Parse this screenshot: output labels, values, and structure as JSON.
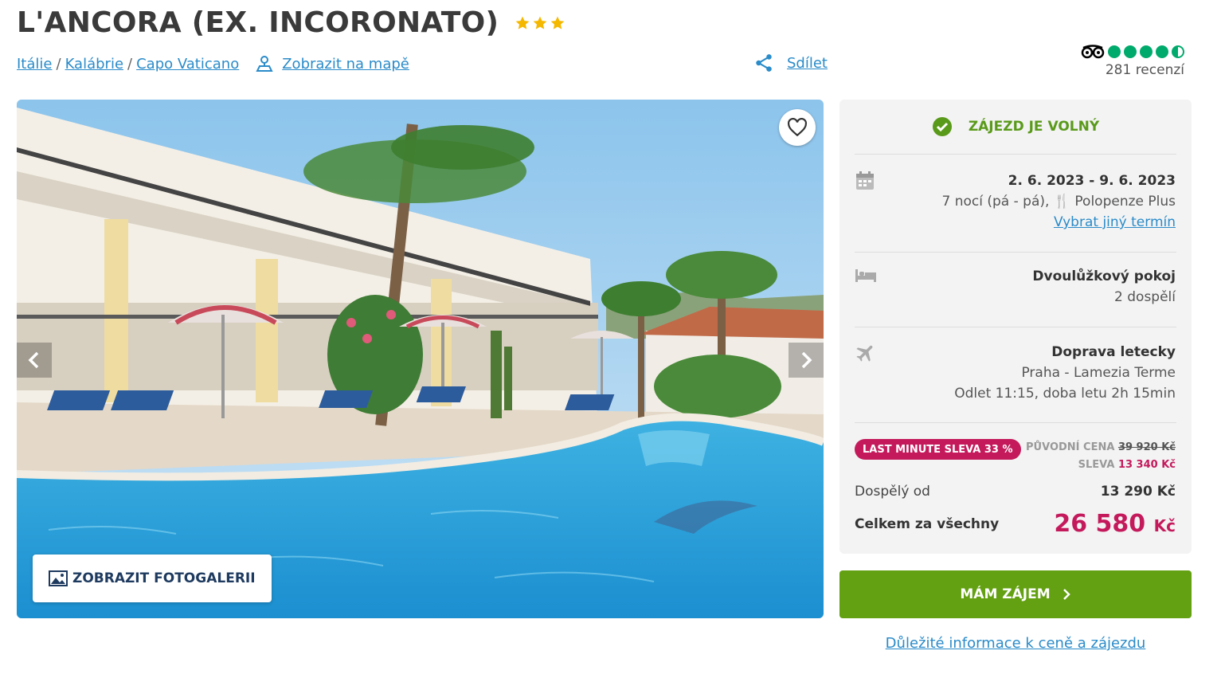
{
  "hotel": {
    "name": "L'ANCORA (EX. INCORONATO)",
    "stars": 3
  },
  "breadcrumb": [
    "Itálie",
    "Kalábrie",
    "Capo Vaticano"
  ],
  "map_link": "Zobrazit na mapě",
  "share_label": "Sdílet",
  "rating": {
    "score_circles": 4.5,
    "reviews": "281 recenzí",
    "icon": "tripadvisor-owl-icon"
  },
  "gallery": {
    "button_label": "ZOBRAZIT FOTOGALERII"
  },
  "booking": {
    "status": "ZÁJEZD JE VOLNÝ",
    "dates": "2. 6. 2023 - 9. 6. 2023",
    "nights": "7 nocí (pá - pá),",
    "board": "Polopenze Plus",
    "change_date": "Vybrat jiný termín",
    "room": "Dvoulůžkový pokoj",
    "guests": "2 dospělí",
    "transport": "Doprava letecky",
    "route": "Praha - Lamezia Terme",
    "departure": "Odlet 11:15, doba letu 2h 15min",
    "badge": "LAST MINUTE SLEVA 33 %",
    "orig_label": "PŮVODNÍ CENA",
    "orig_price": "39 920 Kč",
    "discount_label": "SLEVA",
    "discount_value": "13 340 Kč",
    "adult_label": "Dospělý od",
    "adult_price": "13 290 Kč",
    "total_label": "Celkem za všechny",
    "total_amount": "26 580",
    "currency": "Kč"
  },
  "cta_label": "MÁM ZÁJEM",
  "info_link": "Důležité informace k ceně a zájezdu",
  "colors": {
    "link": "#2a8bc9",
    "accent_green": "#63a012",
    "status_green": "#5a9a1a",
    "price_magenta": "#c41a5c",
    "star_yellow": "#f5b800",
    "tripadvisor_green": "#00aa6c"
  }
}
